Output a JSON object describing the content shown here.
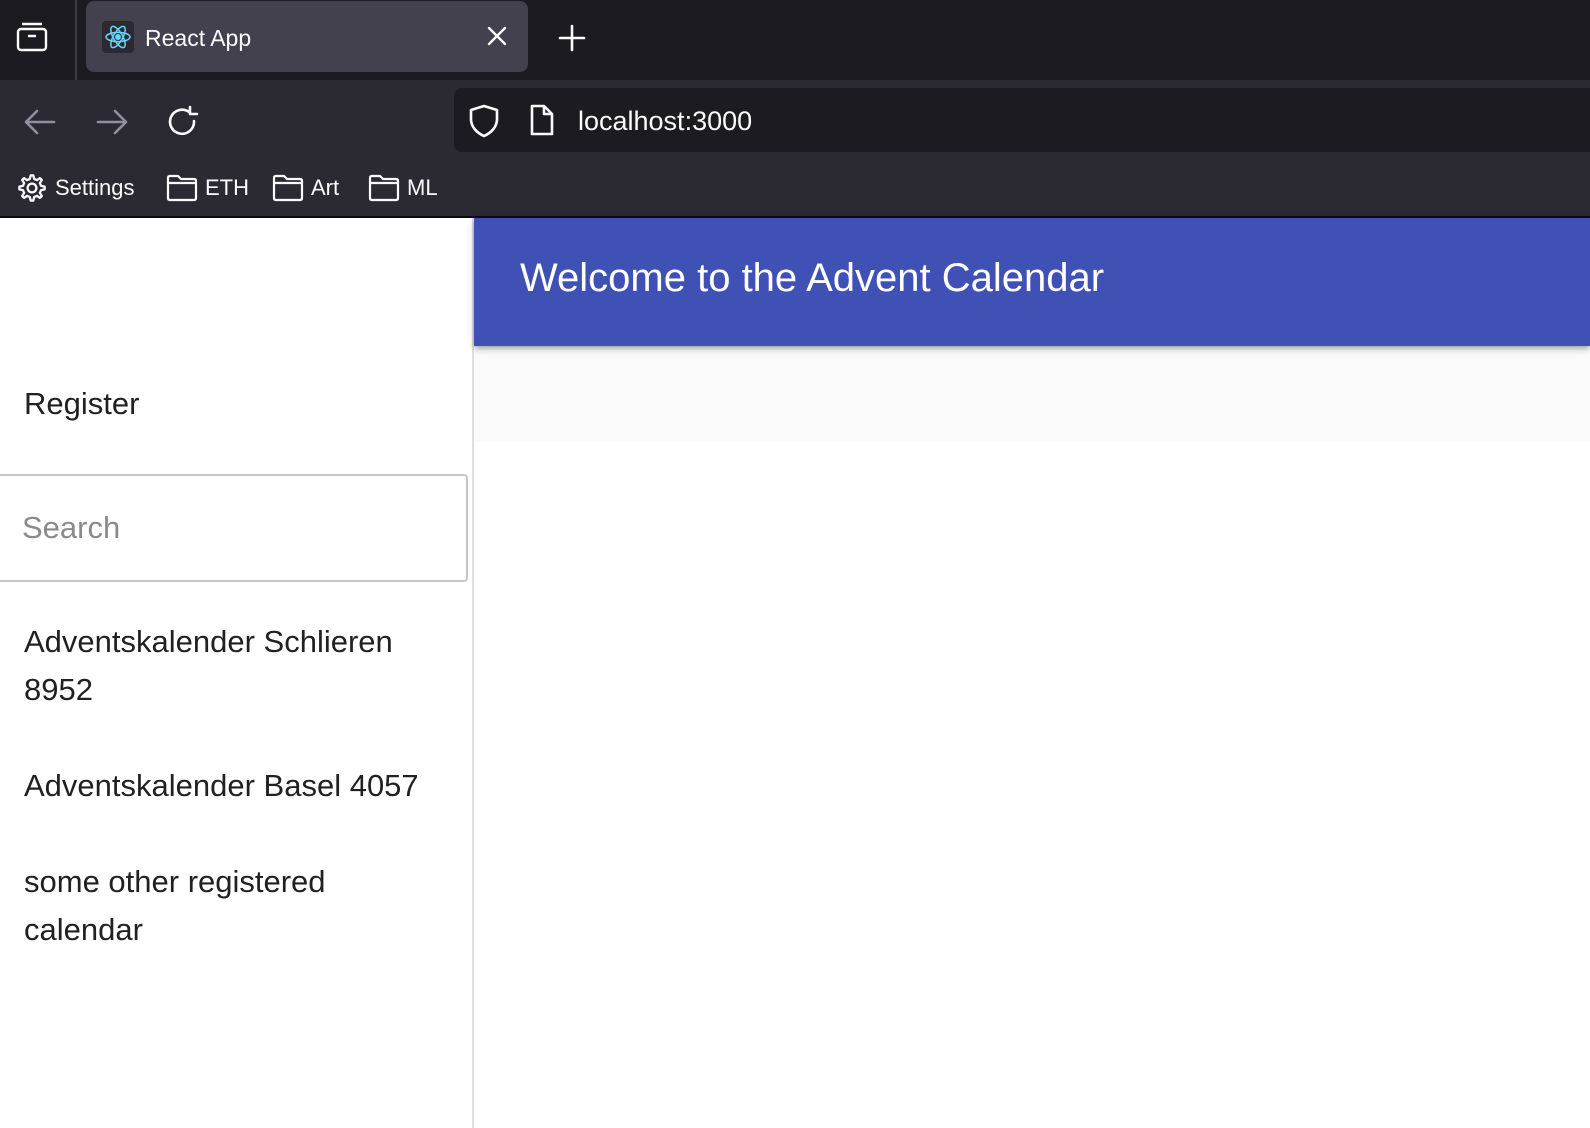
{
  "browser": {
    "tab": {
      "title": "React App"
    },
    "url": "localhost:3000",
    "bookmarks": [
      {
        "label": "Settings",
        "icon": "gear-icon"
      },
      {
        "label": "ETH",
        "icon": "folder-icon"
      },
      {
        "label": "Art",
        "icon": "folder-icon"
      },
      {
        "label": "ML",
        "icon": "folder-icon"
      }
    ]
  },
  "app": {
    "header_title": "Welcome to the Advent Calendar",
    "sidebar": {
      "register_label": "Register",
      "search_placeholder": "Search",
      "search_value": "",
      "calendars": [
        "Adventskalender Schlieren 8952",
        "Adventskalender Basel 4057",
        "some other registered calendar"
      ]
    }
  },
  "colors": {
    "appbar": "#3f51b5",
    "chrome_dark": "#1c1b22",
    "chrome": "#2b2a33",
    "tab_active": "#42414d"
  }
}
